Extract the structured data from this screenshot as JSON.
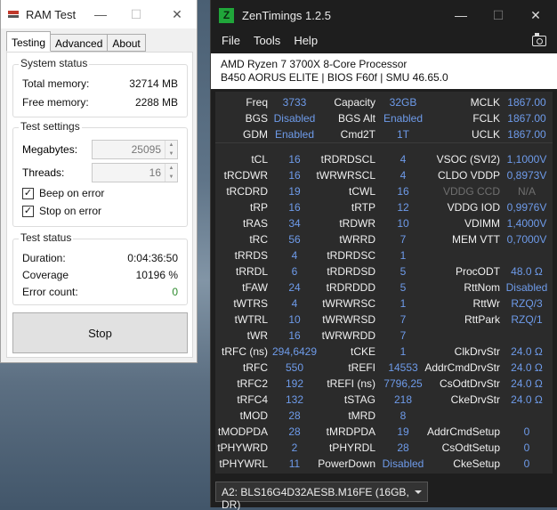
{
  "ramtest": {
    "title": "RAM Test",
    "tabs": [
      "Testing",
      "Advanced",
      "About"
    ],
    "system_status": {
      "label": "System status",
      "total_memory_label": "Total memory:",
      "total_memory": "32714 MB",
      "free_memory_label": "Free memory:",
      "free_memory": "2288 MB"
    },
    "test_settings": {
      "label": "Test settings",
      "megabytes_label": "Megabytes:",
      "megabytes": "25095",
      "threads_label": "Threads:",
      "threads": "16",
      "beep_label": "Beep on error",
      "beep_checked": true,
      "stop_label": "Stop on error",
      "stop_checked": true
    },
    "test_status": {
      "label": "Test status",
      "duration_label": "Duration:",
      "duration": "0:04:36:50",
      "coverage_label": "Coverage",
      "coverage": "10196 %",
      "errors_label": "Error count:",
      "errors": "0",
      "error_color": "#2e8b2e"
    },
    "stop_button": "Stop"
  },
  "zen": {
    "title": "ZenTimings 1.2.5",
    "logo": "Z",
    "menu": [
      "File",
      "Tools",
      "Help"
    ],
    "cpu": "AMD Ryzen 7 3700X 8-Core Processor",
    "board": "B450 AORUS ELITE | BIOS F60f | SMU 46.65.0",
    "top": [
      [
        "Freq",
        "3733",
        "Capacity",
        "32GB",
        "MCLK",
        "1867.00"
      ],
      [
        "BGS",
        "Disabled",
        "BGS Alt",
        "Enabled",
        "FCLK",
        "1867.00"
      ],
      [
        "GDM",
        "Enabled",
        "Cmd2T",
        "1T",
        "UCLK",
        "1867.00"
      ]
    ],
    "main": [
      [
        "tCL",
        "16",
        "tRDRDSCL",
        "4",
        "VSOC (SVI2)",
        "1,1000V"
      ],
      [
        "tRCDWR",
        "16",
        "tWRWRSCL",
        "4",
        "CLDO VDDP",
        "0,8973V"
      ],
      [
        "tRCDRD",
        "19",
        "tCWL",
        "16",
        "VDDG CCD",
        "N/A"
      ],
      [
        "tRP",
        "16",
        "tRTP",
        "12",
        "VDDG IOD",
        "0,9976V"
      ],
      [
        "tRAS",
        "34",
        "tRDWR",
        "10",
        "VDIMM",
        "1,4000V"
      ],
      [
        "tRC",
        "56",
        "tWRRD",
        "7",
        "MEM VTT",
        "0,7000V"
      ],
      [
        "tRRDS",
        "4",
        "tRDRDSC",
        "1",
        "",
        ""
      ],
      [
        "tRRDL",
        "6",
        "tRDRDSD",
        "5",
        "ProcODT",
        "48.0 Ω"
      ],
      [
        "tFAW",
        "24",
        "tRDRDDD",
        "5",
        "RttNom",
        "Disabled"
      ],
      [
        "tWTRS",
        "4",
        "tWRWRSC",
        "1",
        "RttWr",
        "RZQ/3"
      ],
      [
        "tWTRL",
        "10",
        "tWRWRSD",
        "7",
        "RttPark",
        "RZQ/1"
      ],
      [
        "tWR",
        "16",
        "tWRWRDD",
        "7",
        "",
        ""
      ],
      [
        "tRFC (ns)",
        "294,6429",
        "tCKE",
        "1",
        "ClkDrvStr",
        "24.0 Ω"
      ],
      [
        "tRFC",
        "550",
        "tREFI",
        "14553",
        "AddrCmdDrvStr",
        "24.0 Ω"
      ],
      [
        "tRFC2",
        "192",
        "tREFI (ns)",
        "7796,25",
        "CsOdtDrvStr",
        "24.0 Ω"
      ],
      [
        "tRFC4",
        "132",
        "tSTAG",
        "218",
        "CkeDrvStr",
        "24.0 Ω"
      ],
      [
        "tMOD",
        "28",
        "tMRD",
        "8",
        "",
        ""
      ],
      [
        "tMODPDA",
        "28",
        "tMRDPDA",
        "19",
        "AddrCmdSetup",
        "0"
      ],
      [
        "tPHYWRD",
        "2",
        "tPHYRDL",
        "28",
        "CsOdtSetup",
        "0"
      ],
      [
        "tPHYWRL",
        "11",
        "PowerDown",
        "Disabled",
        "CkeSetup",
        "0"
      ]
    ],
    "dim_labels": [
      "VDDG CCD"
    ],
    "dimm_select": "A2: BLS16G4D32AESB.M16FE (16GB, DR)"
  },
  "colors": {
    "value_blue": "#6e9bea",
    "zen_bg": "#1e1e1e",
    "panel_bg": "#2b2b2b"
  }
}
